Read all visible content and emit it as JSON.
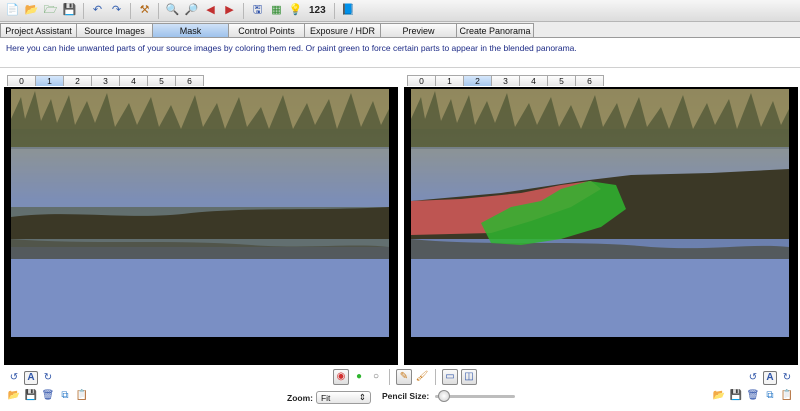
{
  "toolbar": {
    "icons": [
      "new-project-icon",
      "open-icon",
      "open-images-icon",
      "save-icon",
      "undo-icon",
      "redo-icon",
      "tools-icon",
      "zoom-in-icon",
      "zoom-out-icon",
      "previous-icon",
      "next-icon",
      "save-as-icon",
      "grid-icon",
      "tip-icon",
      "counter-icon",
      "help-icon"
    ],
    "counter_text": "123"
  },
  "main_tabs": [
    {
      "label": "Project Assistant",
      "active": false
    },
    {
      "label": "Source Images",
      "active": false
    },
    {
      "label": "Mask",
      "active": true
    },
    {
      "label": "Control Points",
      "active": false
    },
    {
      "label": "Exposure / HDR",
      "active": false
    },
    {
      "label": "Preview",
      "active": false
    },
    {
      "label": "Create Panorama",
      "active": false
    }
  ],
  "instruction": "Here you can hide unwanted parts of your source images by coloring them red. Or paint green to force certain parts to appear in the blended panorama.",
  "left_tabs": {
    "labels": [
      "0",
      "1",
      "2",
      "3",
      "4",
      "5",
      "6"
    ],
    "active_index": 1
  },
  "right_tabs": {
    "labels": [
      "0",
      "1",
      "2",
      "3",
      "4",
      "5",
      "6"
    ],
    "active_index": 2
  },
  "bottom": {
    "zoom_label": "Zoom:",
    "zoom_value": "Fit",
    "pencil_label": "Pencil Size:",
    "pencil_level": 0.05
  },
  "colors": {
    "mask_red": "#d65a5a",
    "mask_green": "#2fb52f",
    "active_tab": "#a9c8ee"
  }
}
